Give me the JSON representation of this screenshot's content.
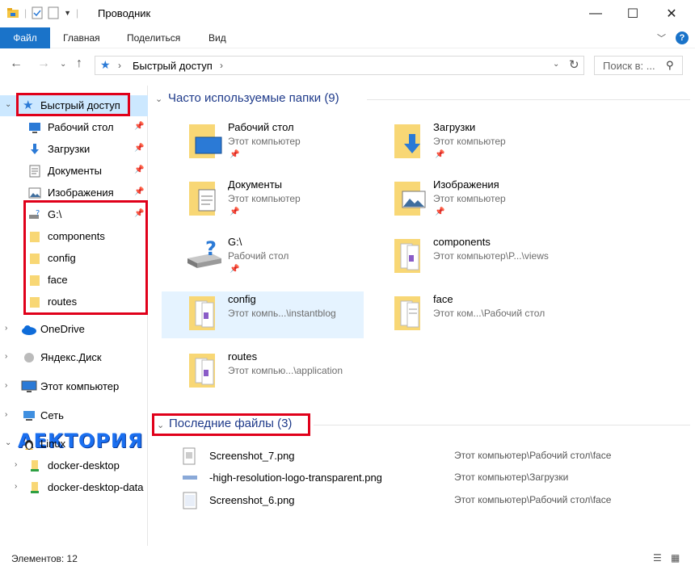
{
  "window": {
    "title": "Проводник"
  },
  "ribbon": {
    "tabs": [
      "Файл",
      "Главная",
      "Поделиться",
      "Вид"
    ]
  },
  "address": {
    "path_label": "Быстрый доступ",
    "search_placeholder": "Поиск в: ..."
  },
  "sidebar": {
    "quick_access": "Быстрый доступ",
    "items": [
      {
        "label": "Рабочий стол",
        "icon": "desktop-icon",
        "pinned": true
      },
      {
        "label": "Загрузки",
        "icon": "downloads-icon",
        "pinned": true
      },
      {
        "label": "Документы",
        "icon": "documents-icon",
        "pinned": true
      },
      {
        "label": "Изображения",
        "icon": "pictures-icon",
        "pinned": true
      },
      {
        "label": "G:\\",
        "icon": "drive-icon",
        "pinned": true
      },
      {
        "label": "components",
        "icon": "folder-icon",
        "pinned": false
      },
      {
        "label": "config",
        "icon": "folder-icon",
        "pinned": false
      },
      {
        "label": "face",
        "icon": "folder-icon",
        "pinned": false
      },
      {
        "label": "routes",
        "icon": "folder-icon",
        "pinned": false
      }
    ],
    "roots": [
      {
        "label": "OneDrive",
        "icon": "cloud-icon"
      },
      {
        "label": "Яндекс.Диск",
        "icon": "yandex-disk-icon"
      },
      {
        "label": "Этот компьютер",
        "icon": "computer-icon"
      },
      {
        "label": "Сеть",
        "icon": "network-icon"
      },
      {
        "label": "Linux",
        "icon": "linux-icon"
      }
    ],
    "linux_children": [
      {
        "label": "docker-desktop"
      },
      {
        "label": "docker-desktop-data"
      }
    ],
    "watermark": "АЕКТОРИЯ"
  },
  "frequent": {
    "title": "Часто используемые папки (9)",
    "items": [
      {
        "name": "Рабочий стол",
        "sub": "Этот компьютер",
        "pinned": true
      },
      {
        "name": "Загрузки",
        "sub": "Этот компьютер",
        "pinned": true
      },
      {
        "name": "Документы",
        "sub": "Этот компьютер",
        "pinned": true
      },
      {
        "name": "Изображения",
        "sub": "Этот компьютер",
        "pinned": true
      },
      {
        "name": "G:\\",
        "sub": "Рабочий стол",
        "pinned": true
      },
      {
        "name": "components",
        "sub": "Этот компьютер\\P...\\views",
        "pinned": false
      },
      {
        "name": "config",
        "sub": "Этот компь...\\instantblog",
        "pinned": false
      },
      {
        "name": "face",
        "sub": "Этот ком...\\Рабочий стол",
        "pinned": false
      },
      {
        "name": "routes",
        "sub": "Этот компью...\\application",
        "pinned": false
      }
    ]
  },
  "recent": {
    "title": "Последние файлы (3)",
    "items": [
      {
        "name": "Screenshot_7.png",
        "path": "Этот компьютер\\Рабочий стол\\face"
      },
      {
        "name": "-high-resolution-logo-transparent.png",
        "path": "Этот компьютер\\Загрузки"
      },
      {
        "name": "Screenshot_6.png",
        "path": "Этот компьютер\\Рабочий стол\\face"
      }
    ]
  },
  "status": {
    "count": "Элементов: 12"
  },
  "colors": {
    "accent": "#1a73c9",
    "selection": "#cce8ff",
    "highlight_box": "#e0001a",
    "section_title": "#1e3a8a"
  }
}
